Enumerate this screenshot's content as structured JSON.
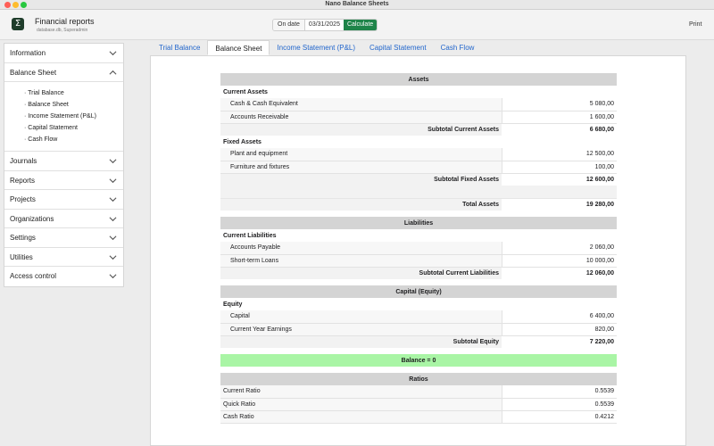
{
  "window": {
    "title": "Nano Balance Sheets"
  },
  "toolbar": {
    "app_name": "Financial reports",
    "app_sub": "database.db, Superadmin",
    "on_date_label": "On date",
    "on_date_value": "03/31/2025",
    "calculate_label": "Calculate",
    "print_label": "Print"
  },
  "sidebar": {
    "items": [
      {
        "label": "Information"
      },
      {
        "label": "Balance Sheet"
      },
      {
        "label": "Journals"
      },
      {
        "label": "Reports"
      },
      {
        "label": "Projects"
      },
      {
        "label": "Organizations"
      },
      {
        "label": "Settings"
      },
      {
        "label": "Utilities"
      },
      {
        "label": "Access control"
      }
    ],
    "sub_items": [
      "· Trial Balance",
      "· Balance Sheet",
      "· Income Statement (P&L)",
      "· Capital Statement",
      "· Cash Flow"
    ]
  },
  "tabs": [
    {
      "label": "Trial Balance"
    },
    {
      "label": "Balance Sheet"
    },
    {
      "label": "Income Statement (P&L)"
    },
    {
      "label": "Capital Statement"
    },
    {
      "label": "Cash Flow"
    }
  ],
  "sheet": {
    "assets_header": "Assets",
    "current_assets": "Current Assets",
    "cash_label": "Cash & Cash Equivalent",
    "cash_value": "5 080,00",
    "receivable_label": "Accounts Receivable",
    "receivable_value": "1 600,00",
    "subtotal_current_assets_label": "Subtotal Current Assets",
    "subtotal_current_assets_value": "6 680,00",
    "fixed_assets": "Fixed Assets",
    "plant_label": "Plant and equipment",
    "plant_value": "12 500,00",
    "furniture_label": "Furniture and fixtures",
    "furniture_value": "100,00",
    "subtotal_fixed_assets_label": "Subtotal Fixed Assets",
    "subtotal_fixed_assets_value": "12 600,00",
    "total_assets_label": "Total Assets",
    "total_assets_value": "19 280,00",
    "liabilities_header": "Liabilities",
    "current_liabilities": "Current Liabilities",
    "payable_label": "Accounts Payable",
    "payable_value": "2 060,00",
    "loans_label": "Short-term Loans",
    "loans_value": "10 000,00",
    "subtotal_liabilities_label": "Subtotal Current Liabilities",
    "subtotal_liabilities_value": "12 060,00",
    "capital_header": "Capital (Equity)",
    "equity": "Equity",
    "capital_label": "Capital",
    "capital_value": "6 400,00",
    "earnings_label": "Current Year Earnings",
    "earnings_value": "820,00",
    "subtotal_equity_label": "Subtotal Equity",
    "subtotal_equity_value": "7 220,00",
    "balance": "Balance = 0",
    "ratios_header": "Ratios",
    "current_ratio_label": "Current Ratio",
    "current_ratio_value": "0.5539",
    "quick_ratio_label": "Quick Ratio",
    "quick_ratio_value": "0.5539",
    "cash_ratio_label": "Cash Ratio",
    "cash_ratio_value": "0.4212"
  },
  "colors": {
    "calculate": "#1e8449",
    "balance_ok": "#a9f5a5",
    "tab_link": "#2266cc"
  }
}
